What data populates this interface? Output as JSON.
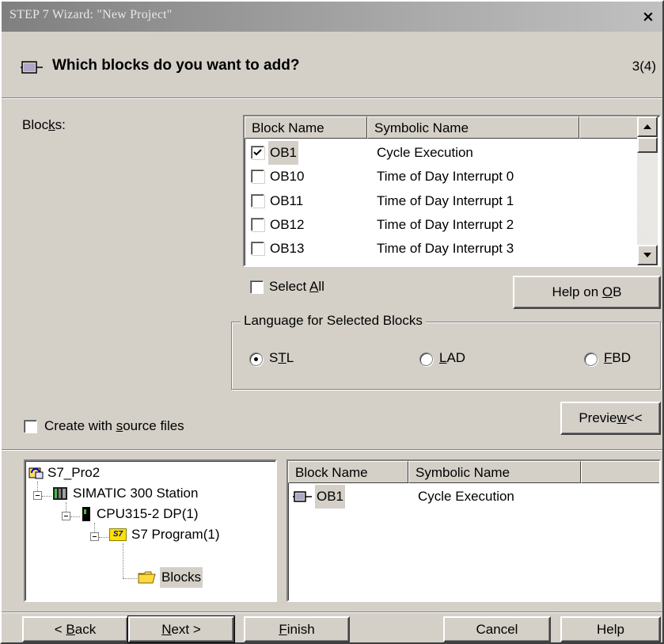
{
  "window": {
    "title": "STEP 7 Wizard: \"New Project\"",
    "close_glyph": "×"
  },
  "header": {
    "title": "Which blocks do you want to add?",
    "step": "3(4)",
    "icon": "block-icon"
  },
  "blocks_label": {
    "before": "Bloc",
    "accel": "k",
    "after": "s:"
  },
  "blocks_list": {
    "columns": [
      "Block Name",
      "Symbolic Name",
      ""
    ],
    "rows": [
      {
        "name": "OB1",
        "symbol": "Cycle Execution",
        "checked": true
      },
      {
        "name": "OB10",
        "symbol": "Time of Day Interrupt 0",
        "checked": false
      },
      {
        "name": "OB11",
        "symbol": "Time of Day Interrupt 1",
        "checked": false
      },
      {
        "name": "OB12",
        "symbol": "Time of Day Interrupt 2",
        "checked": false
      },
      {
        "name": "OB13",
        "symbol": "Time of Day Interrupt 3",
        "checked": false
      }
    ]
  },
  "select_all": {
    "before": "Select ",
    "accel": "A",
    "after": "ll"
  },
  "help_ob": {
    "before": "Help on ",
    "accel": "O",
    "after": "B"
  },
  "language_group": {
    "legend": "Language for Selected Blocks",
    "options": [
      {
        "before": "S",
        "accel": "T",
        "after": "L",
        "selected": true
      },
      {
        "before": "",
        "accel": "L",
        "after": "AD",
        "selected": false
      },
      {
        "before": "",
        "accel": "F",
        "after": "BD",
        "selected": false
      }
    ]
  },
  "source_files": {
    "before": "Create with ",
    "accel": "s",
    "after": "ource files"
  },
  "preview": {
    "before": "Previe",
    "accel": "w",
    "after": "<<"
  },
  "tree": {
    "nodes": [
      {
        "label": "S7_Pro2",
        "icon": "project-icon"
      },
      {
        "label": "SIMATIC 300 Station",
        "icon": "station-icon"
      },
      {
        "label": "CPU315-2 DP(1)",
        "icon": "cpu-icon"
      },
      {
        "label": "S7 Program(1)",
        "icon": "program-icon",
        "badge": "S7"
      },
      {
        "label": "Blocks",
        "icon": "folder-icon"
      }
    ]
  },
  "preview_list": {
    "columns": [
      "Block Name",
      "Symbolic Name",
      ""
    ],
    "rows": [
      {
        "name": "OB1",
        "symbol": "Cycle Execution"
      }
    ]
  },
  "buttons": {
    "back": {
      "before": "< ",
      "accel": "B",
      "after": "ack"
    },
    "next": {
      "before": "",
      "accel": "N",
      "after": "ext >"
    },
    "finish": {
      "before": "",
      "accel": "F",
      "after": "inish"
    },
    "cancel": "Cancel",
    "help": "Help"
  }
}
